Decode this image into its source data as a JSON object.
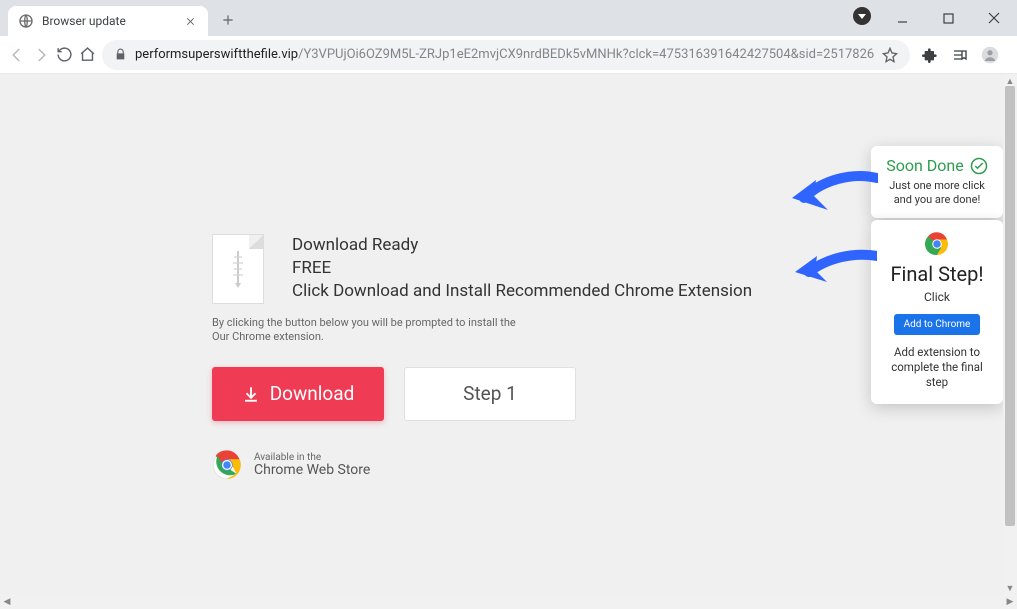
{
  "window": {
    "tab_title": "Browser update",
    "minimize_tooltip": "Minimize",
    "maximize_tooltip": "Maximize",
    "close_tooltip": "Close"
  },
  "toolbar": {
    "url_host": "performsuperswiftthefile.vip",
    "url_path": "/Y3VPUjOi6OZ9M5L-ZRJp1eE2mvjCX9nrdBEDk5vMNHk?clck=475316391642427504&sid=2517826"
  },
  "page": {
    "headline1": "Download Ready",
    "headline2": "FREE",
    "headline3": "Click Download and Install Recommended Chrome Extension",
    "disclaimer1": "By clicking the button below you will be prompted to install the",
    "disclaimer2": "Our Chrome extension.",
    "download_label": "Download",
    "step_label": "Step 1",
    "store_available": "Available in the",
    "store_name": "Chrome Web Store"
  },
  "card_soon": {
    "title": "Soon Done",
    "subtitle": "Just one more click and you are done!"
  },
  "card_final": {
    "title": "Final Step!",
    "subtitle": "Click",
    "button": "Add to Chrome",
    "hint": "Add extension to complete the final step"
  }
}
